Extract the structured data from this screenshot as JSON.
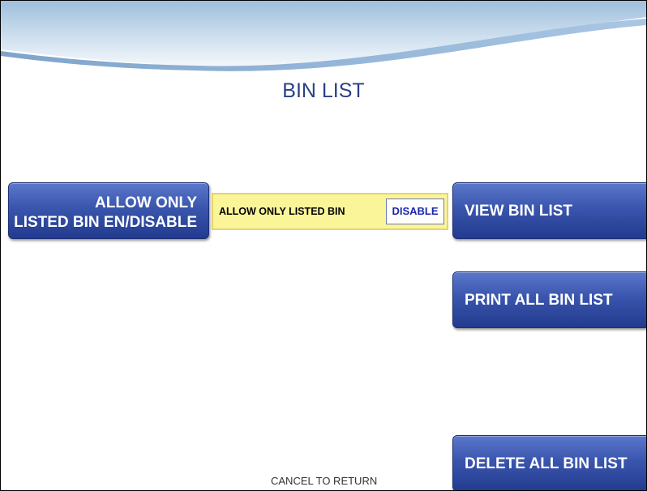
{
  "screen": {
    "title": "BIN LIST"
  },
  "left_buttons": {
    "allow_only_line1": "ALLOW ONLY",
    "allow_only_line2": "LISTED BIN EN/DISABLE"
  },
  "status": {
    "label": "ALLOW ONLY LISTED BIN",
    "value": "DISABLE"
  },
  "right_buttons": {
    "view": "VIEW BIN LIST",
    "print": "PRINT ALL BIN LIST",
    "delete": "DELETE ALL BIN LIST"
  },
  "footer": {
    "text": "CANCEL TO RETURN"
  },
  "colors": {
    "button_blue": "#3a55ad",
    "title_blue": "#2b3f86",
    "status_bg": "#fbf59a",
    "value_text": "#1a27a6"
  }
}
